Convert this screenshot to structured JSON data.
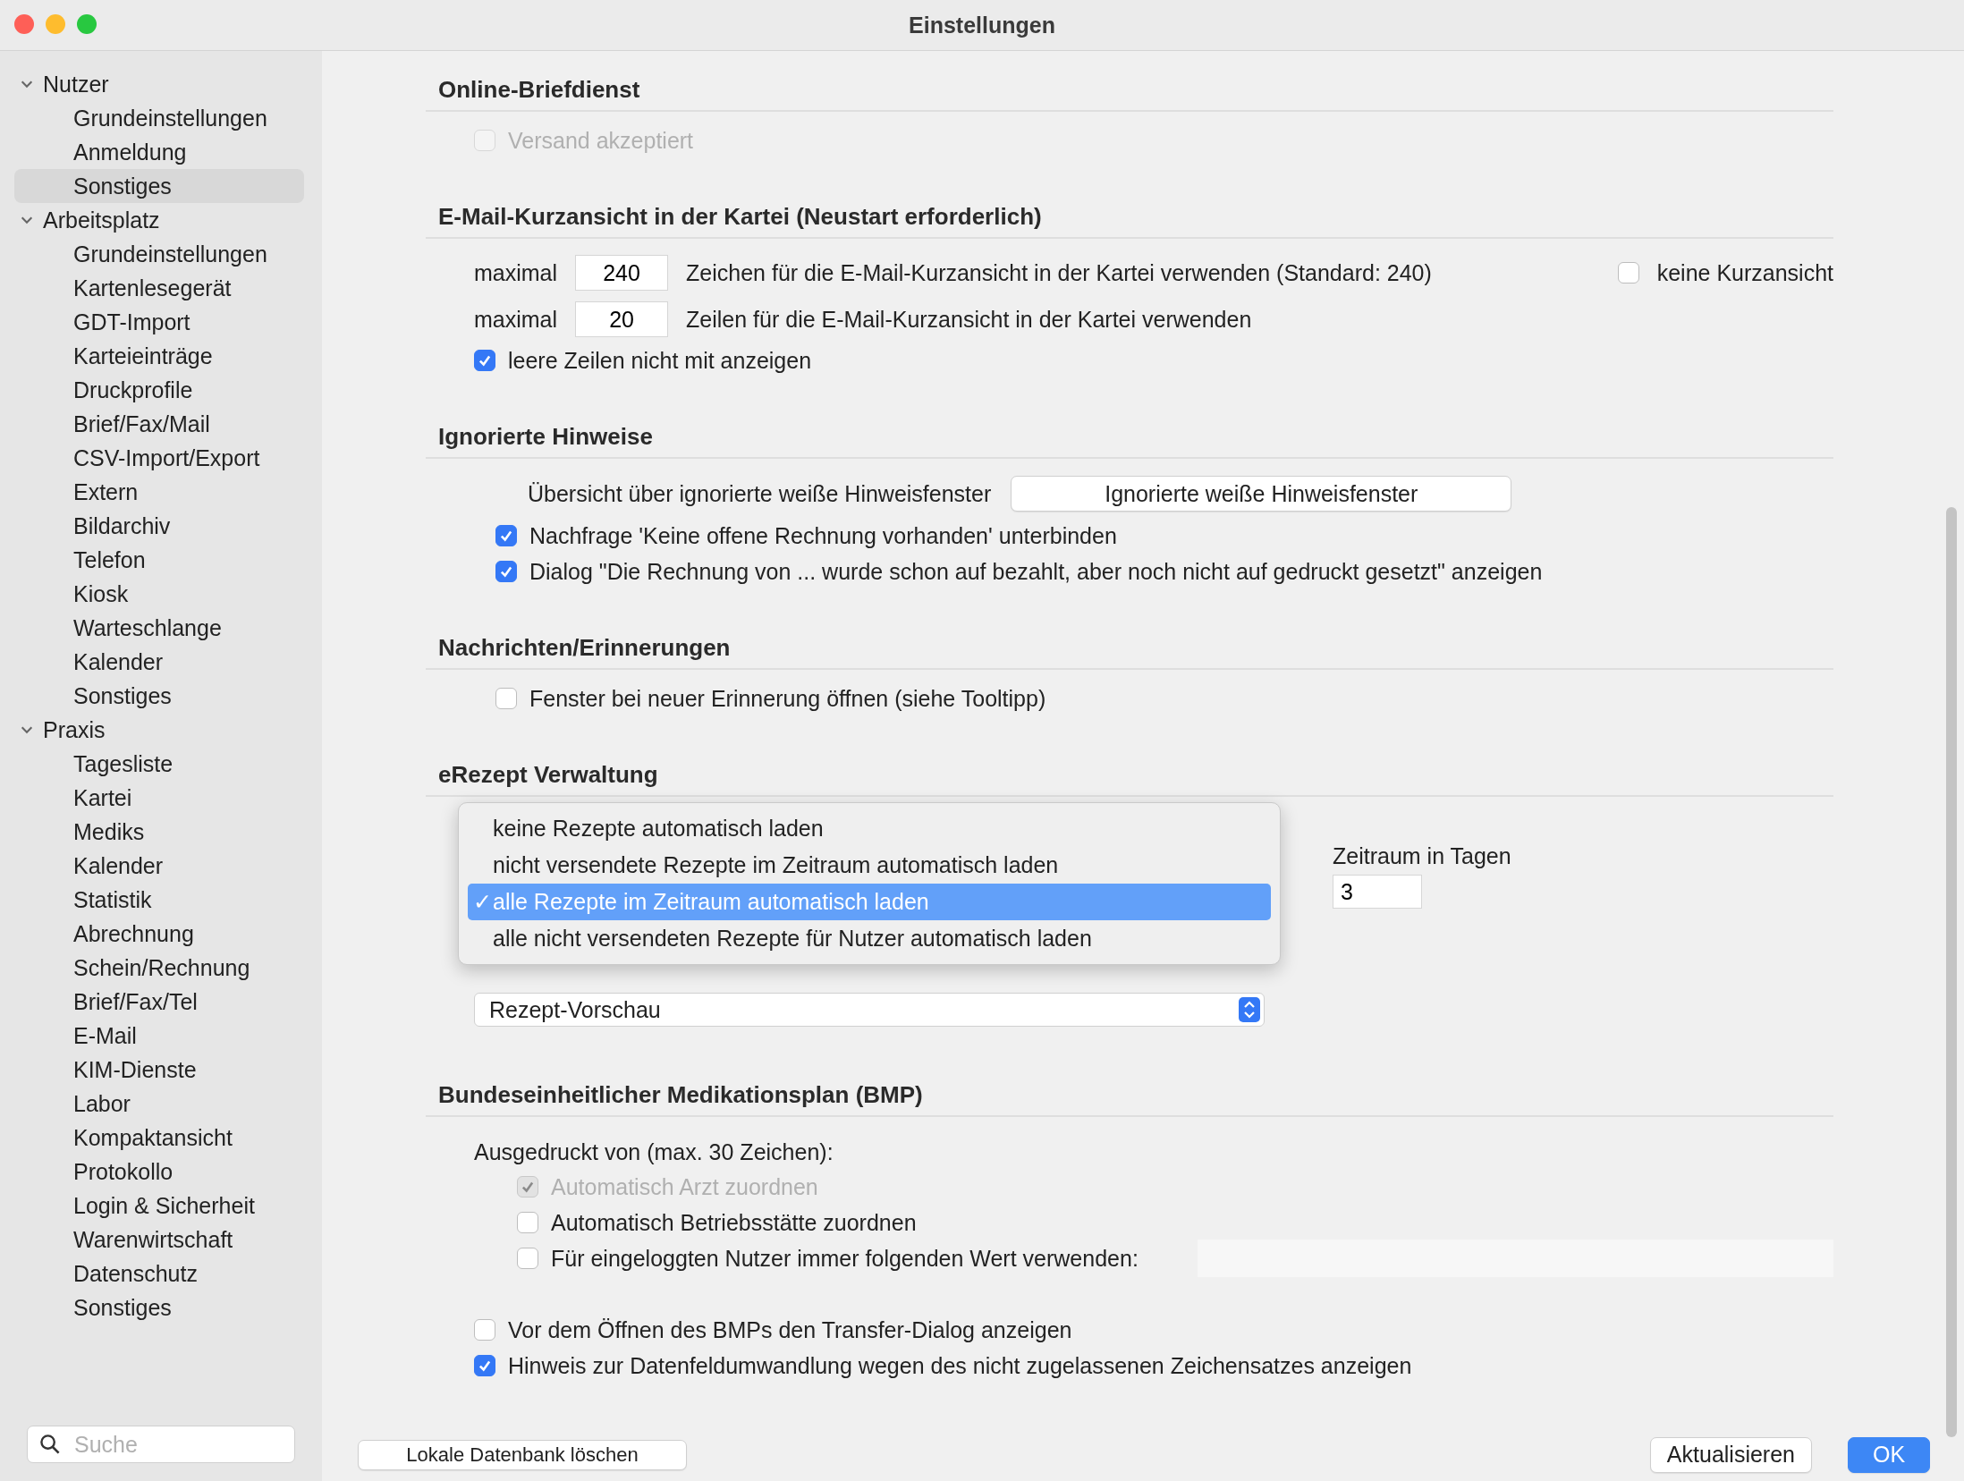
{
  "window": {
    "title": "Einstellungen"
  },
  "sidebar": {
    "items": [
      {
        "label": "Nutzer",
        "expanded": true,
        "selected": false,
        "children": [
          {
            "label": "Grundeinstellungen",
            "selected": false
          },
          {
            "label": "Anmeldung",
            "selected": false
          },
          {
            "label": "Sonstiges",
            "selected": true
          }
        ]
      },
      {
        "label": "Arbeitsplatz",
        "expanded": true,
        "selected": false,
        "children": [
          {
            "label": "Grundeinstellungen",
            "selected": false
          },
          {
            "label": "Kartenlesegerät",
            "selected": false
          },
          {
            "label": "GDT-Import",
            "selected": false
          },
          {
            "label": "Karteieinträge",
            "selected": false
          },
          {
            "label": "Druckprofile",
            "selected": false
          },
          {
            "label": "Brief/Fax/Mail",
            "selected": false
          },
          {
            "label": "CSV-Import/Export",
            "selected": false
          },
          {
            "label": "Extern",
            "selected": false
          },
          {
            "label": "Bildarchiv",
            "selected": false
          },
          {
            "label": "Telefon",
            "selected": false
          },
          {
            "label": "Kiosk",
            "selected": false
          },
          {
            "label": "Warteschlange",
            "selected": false
          },
          {
            "label": "Kalender",
            "selected": false
          },
          {
            "label": "Sonstiges",
            "selected": false
          }
        ]
      },
      {
        "label": "Praxis",
        "expanded": true,
        "selected": false,
        "children": [
          {
            "label": "Tagesliste",
            "selected": false
          },
          {
            "label": "Kartei",
            "selected": false
          },
          {
            "label": "Mediks",
            "selected": false
          },
          {
            "label": "Kalender",
            "selected": false
          },
          {
            "label": "Statistik",
            "selected": false
          },
          {
            "label": "Abrechnung",
            "selected": false
          },
          {
            "label": "Schein/Rechnung",
            "selected": false
          },
          {
            "label": "Brief/Fax/Tel",
            "selected": false
          },
          {
            "label": "E-Mail",
            "selected": false
          },
          {
            "label": "KIM-Dienste",
            "selected": false
          },
          {
            "label": "Labor",
            "selected": false
          },
          {
            "label": "Kompaktansicht",
            "selected": false
          },
          {
            "label": "Protokollo",
            "selected": false
          },
          {
            "label": "Login & Sicherheit",
            "selected": false
          },
          {
            "label": "Warenwirtschaft",
            "selected": false
          },
          {
            "label": "Datenschutz",
            "selected": false
          },
          {
            "label": "Sonstiges",
            "selected": false
          }
        ]
      }
    ],
    "search": {
      "placeholder": "Suche"
    }
  },
  "sections": [
    {
      "title": "Online-Briefdienst",
      "rows": [
        {
          "kind": "checkbox",
          "label": "Versand akzeptiert",
          "checked": false,
          "disabled": true
        }
      ]
    },
    {
      "title": "E-Mail-Kurzansicht in der Kartei (Neustart erforderlich)",
      "rows": [
        {
          "kind": "number",
          "prefix": "maximal",
          "value": "240",
          "label": "Zeichen für die E-Mail-Kurzansicht in der Kartei verwenden (Standard: 240)",
          "extra": {
            "label": "keine Kurzansicht",
            "checked": false
          }
        },
        {
          "kind": "number",
          "prefix": "maximal",
          "value": "20",
          "label": "Zeilen für die E-Mail-Kurzansicht in der Kartei verwenden"
        },
        {
          "kind": "checkbox",
          "label": "leere Zeilen nicht mit anzeigen",
          "checked": true,
          "disabled": false
        }
      ]
    },
    {
      "title": "Ignorierte Hinweise",
      "rows": [
        {
          "kind": "button",
          "label": "Übersicht über ignorierte weiße Hinweisfenster",
          "button": "Ignorierte weiße Hinweisfenster"
        },
        {
          "kind": "checkbox",
          "label": "Nachfrage 'Keine offene Rechnung vorhanden' unterbinden",
          "checked": true,
          "disabled": false
        },
        {
          "kind": "checkbox",
          "label": "Dialog \"Die Rechnung von ... wurde schon auf bezahlt, aber noch nicht auf gedruckt gesetzt\" anzeigen",
          "checked": true,
          "disabled": false
        }
      ]
    },
    {
      "title": "Nachrichten/Erinnerungen",
      "rows": [
        {
          "kind": "checkbox",
          "label": "Fenster bei neuer Erinnerung öffnen (siehe Tooltipp)",
          "checked": false,
          "disabled": false
        }
      ]
    },
    {
      "title": "eRezept Verwaltung",
      "rows": [
        {
          "kind": "load",
          "options": [
            {
              "label": "keine Rezepte automatisch laden",
              "selected": false
            },
            {
              "label": "nicht versendete Rezepte im Zeitraum automatisch laden",
              "selected": false
            },
            {
              "label": "alle Rezepte im Zeitraum automatisch laden",
              "selected": true
            },
            {
              "label": "alle nicht versendeten Rezepte für Nutzer automatisch laden",
              "selected": false
            }
          ],
          "check_mark": "✓",
          "period": {
            "label": "Zeitraum in Tagen",
            "value": "3"
          }
        },
        {
          "kind": "select",
          "value": "Rezept-Vorschau"
        }
      ]
    },
    {
      "title": "Bundeseinheitlicher Medikationsplan (BMP)",
      "rows": [
        {
          "kind": "label",
          "label": "Ausgedruckt von (max. 30 Zeichen):",
          "children": [
            {
              "kind": "checkbox",
              "label": "Automatisch Arzt zuordnen",
              "checked": true,
              "disabled": true
            },
            {
              "kind": "checkbox",
              "label": "Automatisch Betriebsstätte zuordnen",
              "checked": false,
              "disabled": false
            },
            {
              "kind": "checkbox_field",
              "label": "Für eingeloggten Nutzer immer folgenden Wert verwenden:",
              "checked": false,
              "disabled": false
            }
          ]
        },
        {
          "kind": "checkbox",
          "label": "Vor dem Öffnen des BMPs den Transfer-Dialog anzeigen",
          "checked": false,
          "disabled": false
        },
        {
          "kind": "checkbox",
          "label": "Hinweis zur Datenfeldumwandlung wegen des nicht zugelassenen Zeichensatzes anzeigen",
          "checked": true,
          "disabled": false
        }
      ]
    }
  ],
  "footer": {
    "left_button": "Lokale Datenbank löschen",
    "buttons": [
      {
        "label": "Aktualisieren",
        "primary": false
      },
      {
        "label": "OK",
        "primary": true
      }
    ]
  }
}
